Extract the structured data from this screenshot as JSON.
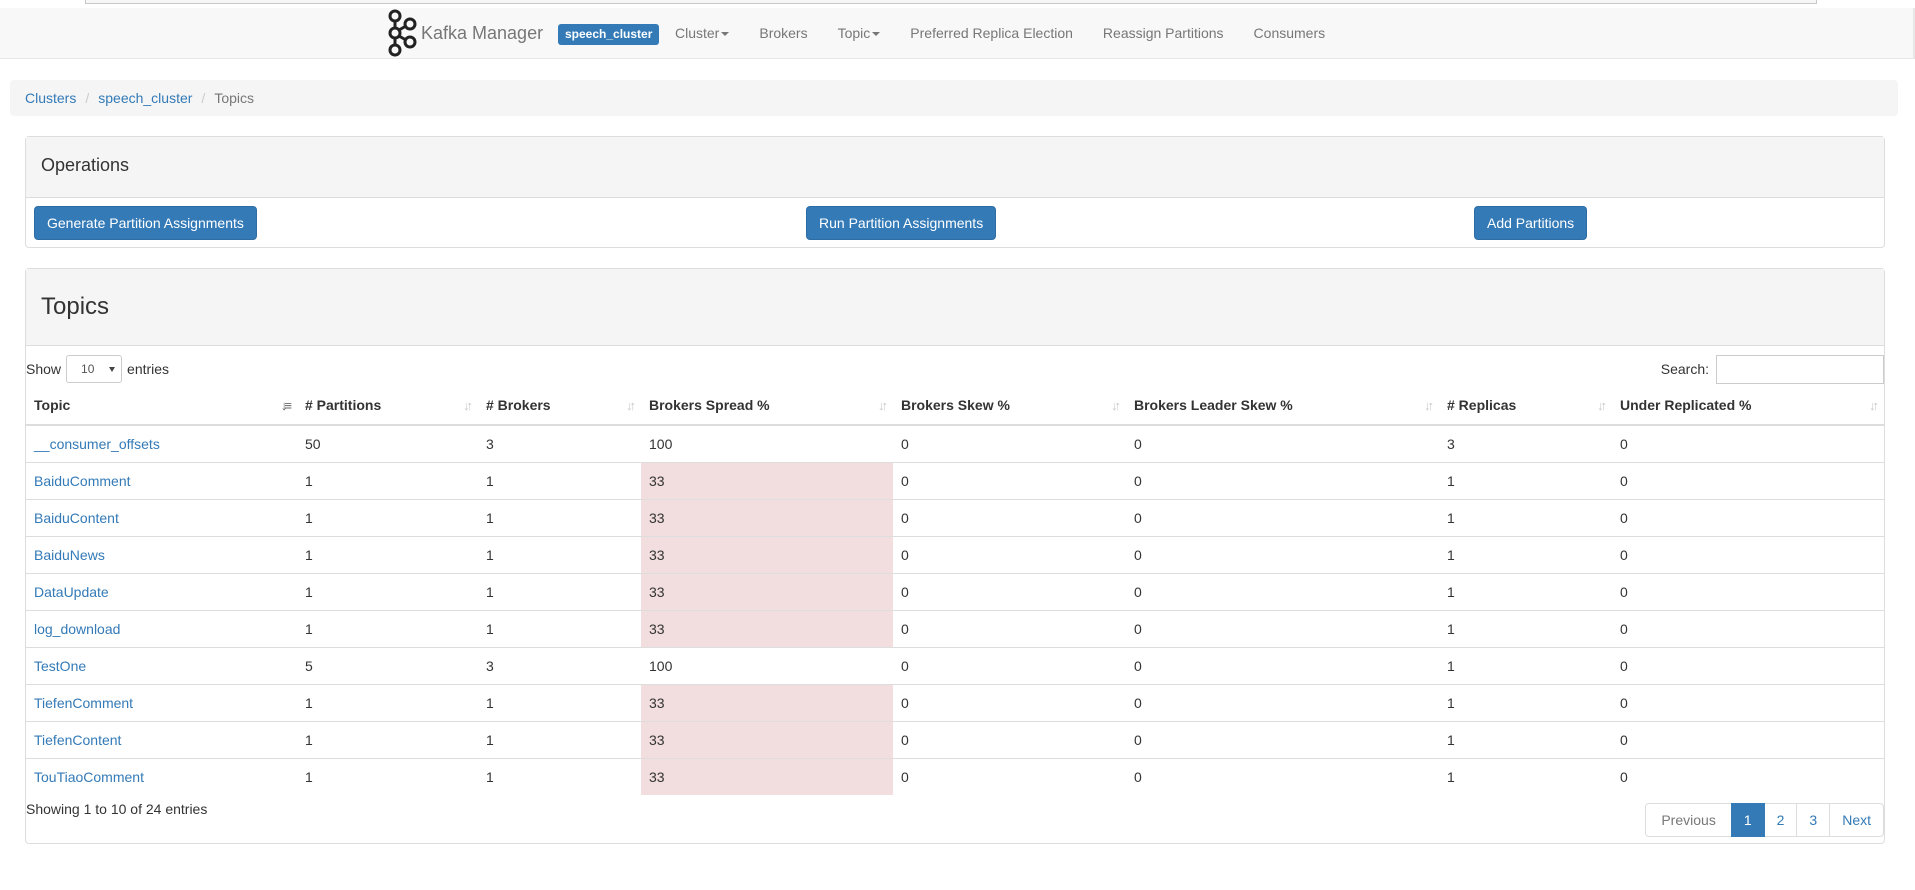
{
  "app": {
    "name": "Kafka Manager",
    "cluster_badge": "speech_cluster"
  },
  "nav": {
    "cluster": "Cluster",
    "brokers": "Brokers",
    "topic": "Topic",
    "preferred_replica_election": "Preferred Replica Election",
    "reassign_partitions": "Reassign Partitions",
    "consumers": "Consumers"
  },
  "breadcrumb": {
    "clusters": "Clusters",
    "cluster": "speech_cluster",
    "current": "Topics"
  },
  "operations": {
    "title": "Operations",
    "generate": "Generate Partition Assignments",
    "run": "Run Partition Assignments",
    "add": "Add Partitions"
  },
  "topics": {
    "title": "Topics",
    "show_label": "Show",
    "entries_label": "entries",
    "page_length": "10",
    "search_label": "Search:",
    "search_value": "",
    "columns": [
      "Topic",
      "# Partitions",
      "# Brokers",
      "Brokers Spread %",
      "Brokers Skew %",
      "Brokers Leader Skew %",
      "# Replicas",
      "Under Replicated %"
    ],
    "rows": [
      {
        "topic": "__consumer_offsets",
        "partitions": "50",
        "brokers": "3",
        "spread": "100",
        "skew": "0",
        "leader_skew": "0",
        "replicas": "3",
        "under_replicated": "0",
        "spread_warning": false
      },
      {
        "topic": "BaiduComment",
        "partitions": "1",
        "brokers": "1",
        "spread": "33",
        "skew": "0",
        "leader_skew": "0",
        "replicas": "1",
        "under_replicated": "0",
        "spread_warning": true
      },
      {
        "topic": "BaiduContent",
        "partitions": "1",
        "brokers": "1",
        "spread": "33",
        "skew": "0",
        "leader_skew": "0",
        "replicas": "1",
        "under_replicated": "0",
        "spread_warning": true
      },
      {
        "topic": "BaiduNews",
        "partitions": "1",
        "brokers": "1",
        "spread": "33",
        "skew": "0",
        "leader_skew": "0",
        "replicas": "1",
        "under_replicated": "0",
        "spread_warning": true
      },
      {
        "topic": "DataUpdate",
        "partitions": "1",
        "brokers": "1",
        "spread": "33",
        "skew": "0",
        "leader_skew": "0",
        "replicas": "1",
        "under_replicated": "0",
        "spread_warning": true
      },
      {
        "topic": "log_download",
        "partitions": "1",
        "brokers": "1",
        "spread": "33",
        "skew": "0",
        "leader_skew": "0",
        "replicas": "1",
        "under_replicated": "0",
        "spread_warning": true
      },
      {
        "topic": "TestOne",
        "partitions": "5",
        "brokers": "3",
        "spread": "100",
        "skew": "0",
        "leader_skew": "0",
        "replicas": "1",
        "under_replicated": "0",
        "spread_warning": false
      },
      {
        "topic": "TiefenComment",
        "partitions": "1",
        "brokers": "1",
        "spread": "33",
        "skew": "0",
        "leader_skew": "0",
        "replicas": "1",
        "under_replicated": "0",
        "spread_warning": true
      },
      {
        "topic": "TiefenContent",
        "partitions": "1",
        "brokers": "1",
        "spread": "33",
        "skew": "0",
        "leader_skew": "0",
        "replicas": "1",
        "under_replicated": "0",
        "spread_warning": true
      },
      {
        "topic": "TouTiaoComment",
        "partitions": "1",
        "brokers": "1",
        "spread": "33",
        "skew": "0",
        "leader_skew": "0",
        "replicas": "1",
        "under_replicated": "0",
        "spread_warning": true
      }
    ],
    "info": "Showing 1 to 10 of 24 entries",
    "pagination": {
      "previous": "Previous",
      "pages": [
        "1",
        "2",
        "3"
      ],
      "active_page": "1",
      "next": "Next"
    }
  },
  "colors": {
    "primary": "#337ab7",
    "danger_bg": "#f2dede",
    "link": "#337ab7"
  }
}
